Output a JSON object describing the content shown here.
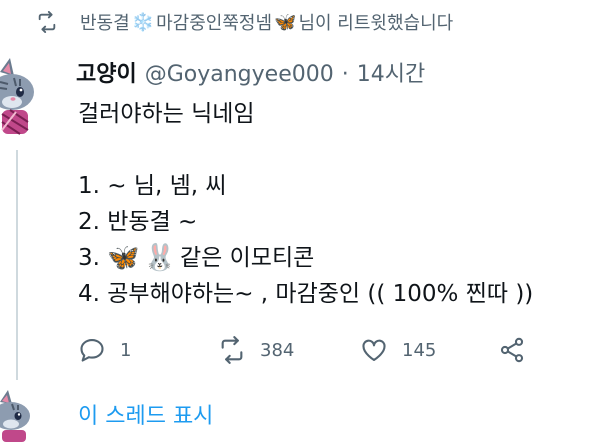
{
  "retweet_notice": {
    "prefix": "반동결",
    "snowflake_emoji": "❄️",
    "middle": "마감중인쭉정넴",
    "butterfly_emoji": "🦋",
    "suffix": " 님이 리트윗했습니다"
  },
  "tweet": {
    "author_name": "고양이",
    "author_handle": "@Goyangyee000",
    "separator": "·",
    "time": "14시간",
    "lines": {
      "l1": "걸러야하는 닉네임",
      "l2": "1. ~ 님, 넴, 씨",
      "l3": "2. 반동결 ~",
      "l4_prefix": "3.",
      "l4_emoji1": "🦋",
      "l4_emoji2": "🐰",
      "l4_suffix": "같은 이모티콘",
      "l5": "4. 공부해야하는~ , 마감중인 (( 100% 찐따 ))"
    },
    "stats": {
      "replies": "1",
      "retweets": "384",
      "likes": "145"
    }
  },
  "show_thread": "이 스레드 표시",
  "colors": {
    "text": "#0f1419",
    "secondary": "#536471",
    "link": "#1d9bf0",
    "thread_line": "#cfd9de"
  }
}
